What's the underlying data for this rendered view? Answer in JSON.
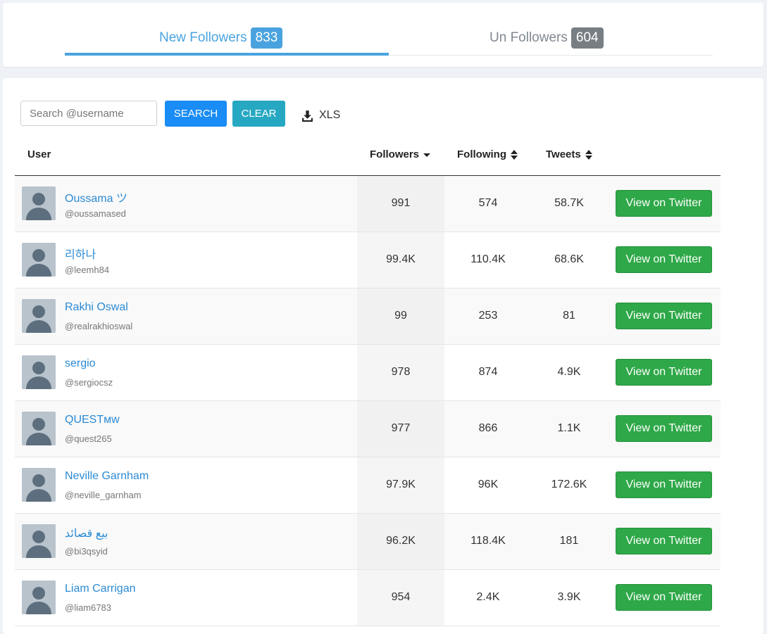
{
  "tabs": {
    "new": {
      "label": "New Followers",
      "count": "833"
    },
    "un": {
      "label": "Un Followers",
      "count": "604"
    }
  },
  "search": {
    "placeholder": "Search @username",
    "search_label": "SEARCH",
    "clear_label": "CLEAR",
    "xls_label": "XLS"
  },
  "table": {
    "headers": {
      "user": "User",
      "followers": "Followers",
      "following": "Following",
      "tweets": "Tweets"
    },
    "rows": [
      {
        "name": "Oussama ツ",
        "handle": "@oussamased",
        "followers": "991",
        "following": "574",
        "tweets": "58.7K",
        "action": "View on Twitter"
      },
      {
        "name": "리하나",
        "handle": "@leemh84",
        "followers": "99.4K",
        "following": "110.4K",
        "tweets": "68.6K",
        "action": "View on Twitter"
      },
      {
        "name": "Rakhi Oswal",
        "handle": "@realrakhioswal",
        "followers": "99",
        "following": "253",
        "tweets": "81",
        "action": "View on Twitter"
      },
      {
        "name": "sergio",
        "handle": "@sergiocsz",
        "followers": "978",
        "following": "874",
        "tweets": "4.9K",
        "action": "View on Twitter"
      },
      {
        "name": "QUESTᴍᴡ",
        "handle": "@quest265",
        "followers": "977",
        "following": "866",
        "tweets": "1.1K",
        "action": "View on Twitter"
      },
      {
        "name": "Neville Garnham",
        "handle": "@neville_garnham",
        "followers": "97.9K",
        "following": "96K",
        "tweets": "172.6K",
        "action": "View on Twitter"
      },
      {
        "name": "بيع قصائد",
        "handle": "@bi3qsyid",
        "followers": "96.2K",
        "following": "118.4K",
        "tweets": "181",
        "action": "View on Twitter"
      },
      {
        "name": "Liam Carrigan",
        "handle": "@liam6783",
        "followers": "954",
        "following": "2.4K",
        "tweets": "3.9K",
        "action": "View on Twitter"
      }
    ]
  }
}
